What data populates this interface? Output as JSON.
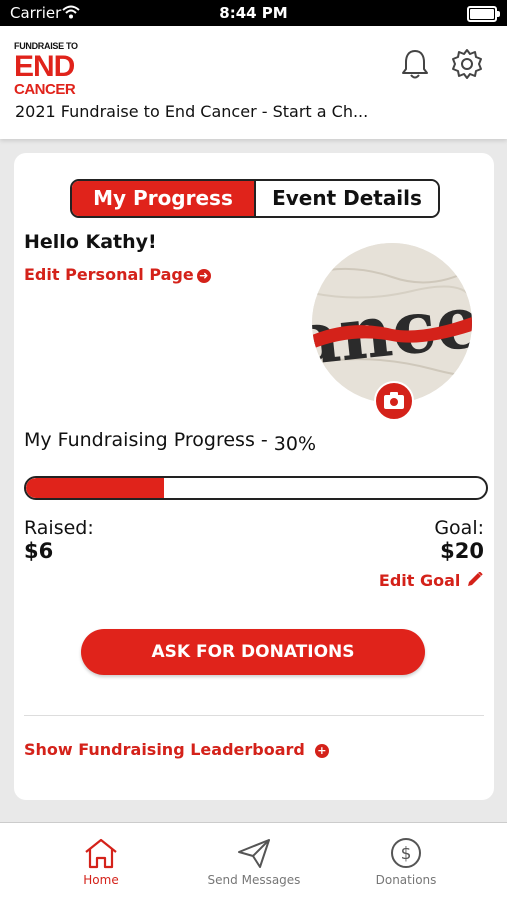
{
  "status": {
    "carrier": "Carrier",
    "time": "8:44 PM"
  },
  "brand": {
    "line1": "FUNDRAISE TO",
    "line2": "END",
    "line3": "CANCER",
    "accent": "#e0231b"
  },
  "header": {
    "title": "2021 Fundraise to End Cancer - Start a Ch..."
  },
  "tabs": {
    "progress": "My Progress",
    "event": "Event Details"
  },
  "greeting": "Hello Kathy!",
  "edit_personal_page": "Edit Personal Page",
  "progress": {
    "title": "My Fundraising Progress -",
    "percent_label": "30%",
    "fraction": 0.3
  },
  "raised": {
    "label": "Raised:",
    "value": "$6"
  },
  "goal": {
    "label": "Goal:",
    "value": "$20",
    "edit": "Edit Goal"
  },
  "ask_button": "ASK FOR DONATIONS",
  "leaderboard": "Show Fundraising Leaderboard",
  "bottom_tabs": [
    {
      "label": "Home",
      "icon": "home-icon",
      "active": true
    },
    {
      "label": "Send Messages",
      "icon": "send-icon",
      "active": false
    },
    {
      "label": "Donations",
      "icon": "dollar-icon",
      "active": false
    }
  ]
}
